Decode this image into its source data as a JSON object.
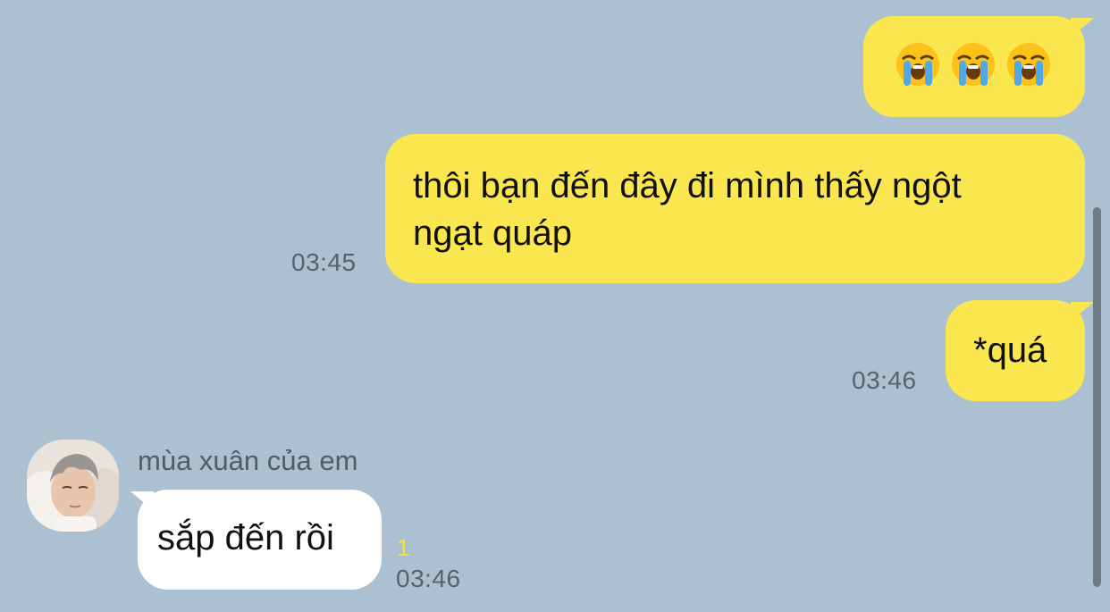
{
  "colors": {
    "background": "#abc1d1",
    "my_bubble": "#fae64f",
    "their_bubble": "#ffffff",
    "timestamp": "#556370",
    "unread": "#f5e23a"
  },
  "messages": [
    {
      "from": "me",
      "type": "emoji",
      "emojis": [
        "loudly-crying-face-icon",
        "loudly-crying-face-icon",
        "loudly-crying-face-icon"
      ]
    },
    {
      "from": "me",
      "text": "thôi bạn đến đây đi mình thấy ngột\nngạt quáp",
      "time": "03:45"
    },
    {
      "from": "me",
      "text": "*quá",
      "time": "03:46"
    },
    {
      "from": "them",
      "sender": "mùa xuân của em",
      "text": "sắp đến rồi",
      "unread": "1",
      "time": "03:46"
    }
  ]
}
